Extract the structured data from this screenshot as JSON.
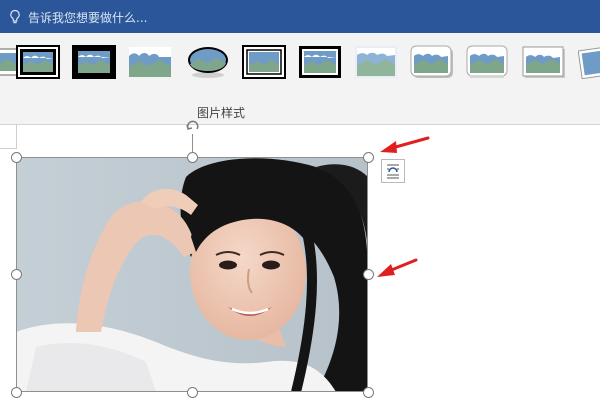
{
  "tellme": {
    "placeholder": "告诉我您想要做什么...",
    "icon": "lightbulb-icon"
  },
  "picture_styles": {
    "group_label": "图片样式",
    "styles": [
      "style-partial-left",
      "style-simple-frame-black",
      "style-thick-black-frame",
      "style-plain",
      "style-oval-shadow",
      "style-double-frame",
      "style-thin-black-border",
      "style-soft-edge",
      "style-rounded-shadow",
      "style-rounded-reflection",
      "style-simple-shadow",
      "style-rotated-white"
    ]
  },
  "picture": {
    "subject": "portrait-photo",
    "selected": true
  },
  "annotations": {
    "arrow_color": "#e02020"
  },
  "colors": {
    "ribbon_blue": "#2b579a",
    "gallery_bg": "#f3f3f3"
  }
}
